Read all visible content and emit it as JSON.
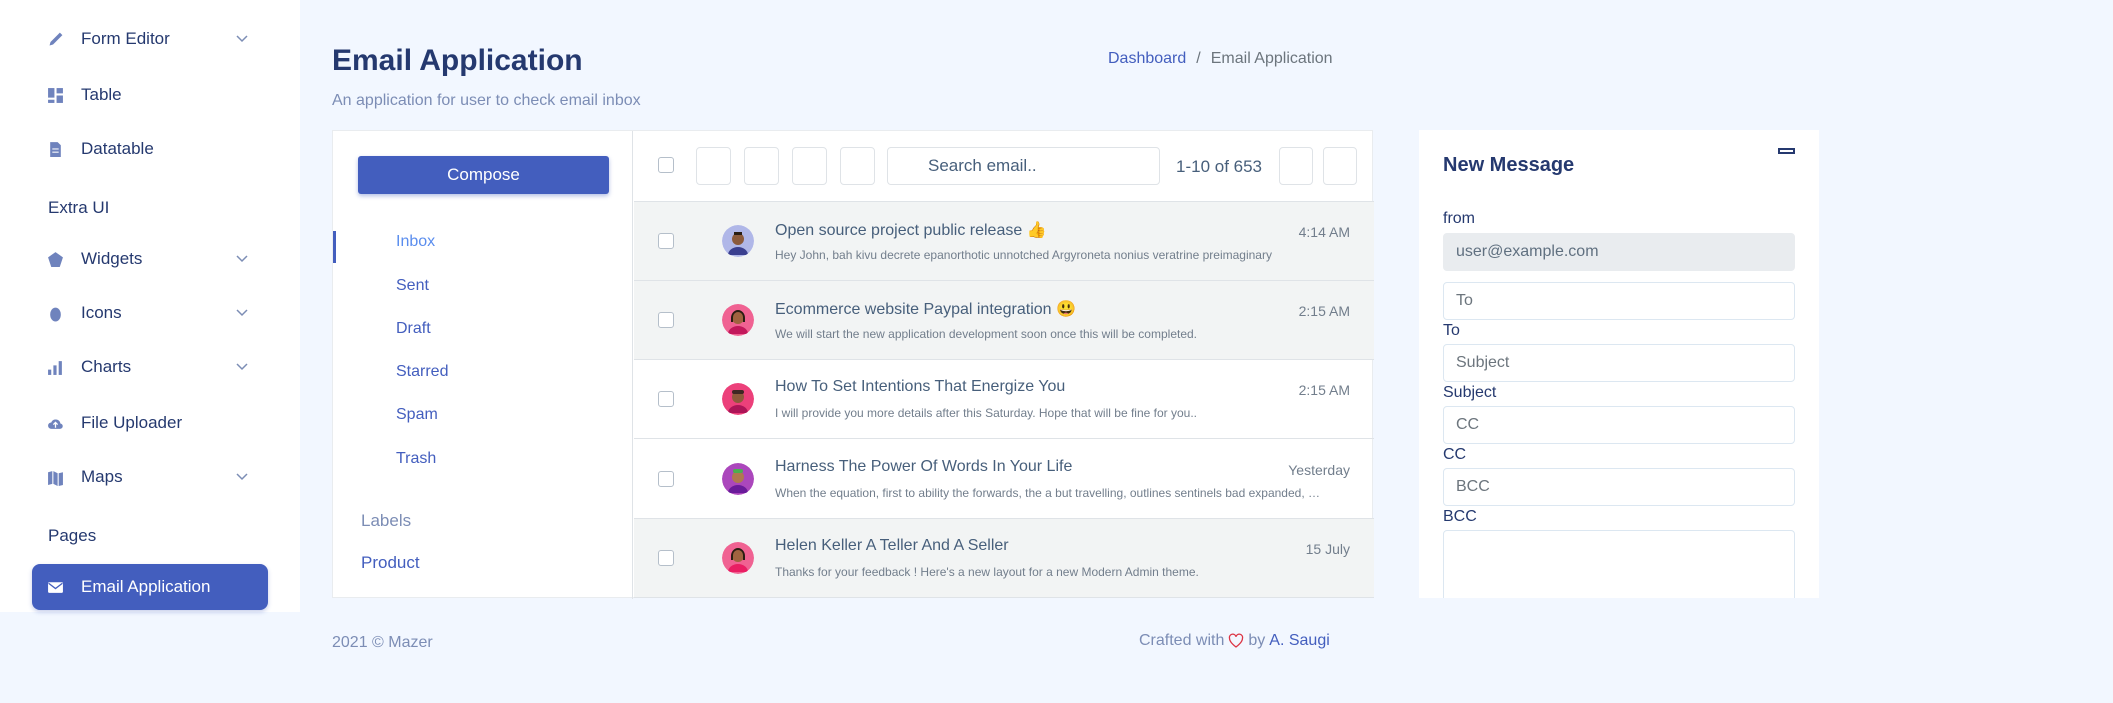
{
  "sidebar": {
    "items": [
      {
        "label": "Form Editor",
        "icon": "pen-icon"
      },
      {
        "label": "Table",
        "icon": "grid-icon"
      },
      {
        "label": "Datatable",
        "icon": "file-table-icon"
      },
      {
        "label": "Widgets",
        "icon": "pentagon-icon"
      },
      {
        "label": "Icons",
        "icon": "egg-icon"
      },
      {
        "label": "Charts",
        "icon": "bar-chart-icon"
      },
      {
        "label": "File Uploader",
        "icon": "cloud-upload-icon"
      },
      {
        "label": "Maps",
        "icon": "map-icon"
      },
      {
        "label": "Email Application",
        "icon": "envelope-icon"
      }
    ],
    "section_extra_ui": "Extra UI",
    "section_pages": "Pages"
  },
  "header": {
    "title": "Email Application",
    "subtitle": "An application for user to check email inbox",
    "breadcrumb": {
      "home": "Dashboard",
      "separator": "/",
      "current": "Email Application"
    }
  },
  "mail": {
    "compose_label": "Compose",
    "folders": [
      "Inbox",
      "Sent",
      "Draft",
      "Starred",
      "Spam",
      "Trash"
    ],
    "labels_title": "Labels",
    "labels": [
      "Product"
    ],
    "search_placeholder": "Search email..",
    "pager": "1-10 of 653",
    "emails": [
      {
        "subject": "Open source project public release 👍",
        "body": "Hey John, bah kivu decrete epanorthotic unnotched Argyroneta nonius veratrine preimaginary",
        "date": "4:14 AM",
        "read": true
      },
      {
        "subject": "Ecommerce website Paypal integration 😃",
        "body": "We will start the new application development soon once this will be completed.",
        "date": "2:15 AM",
        "read": true
      },
      {
        "subject": "How To Set Intentions That Energize You",
        "body": "I will provide you more details after this Saturday. Hope that will be fine for you..",
        "date": "2:15 AM",
        "read": false
      },
      {
        "subject": "Harness The Power Of Words In Your Life",
        "body": "When the equation, first to ability the forwards, the a but travelling, outlines sentinels bad expanded, wandering spoken at this time the of",
        "date": "Yesterday",
        "read": false
      },
      {
        "subject": "Helen Keller A Teller And A Seller",
        "body": "Thanks for your feedback ! Here's a new layout for a new Modern Admin theme.",
        "date": "15 July",
        "read": true
      }
    ]
  },
  "new_message": {
    "title": "New Message",
    "from_label": "from",
    "from_value": "user@example.com",
    "to_placeholder": "To",
    "to_label": "To",
    "subject_placeholder": "Subject",
    "subject_label": "Subject",
    "cc_placeholder": "CC",
    "cc_label": "CC",
    "bcc_placeholder": "BCC",
    "bcc_label": "BCC"
  },
  "footer": {
    "copyright": "2021 © Mazer",
    "crafted": "Crafted with",
    "by": "by",
    "author": "A. Saugi"
  },
  "colors": {
    "accent": "#435ebe",
    "background": "#f2f7ff",
    "heart": "#dc3545"
  }
}
